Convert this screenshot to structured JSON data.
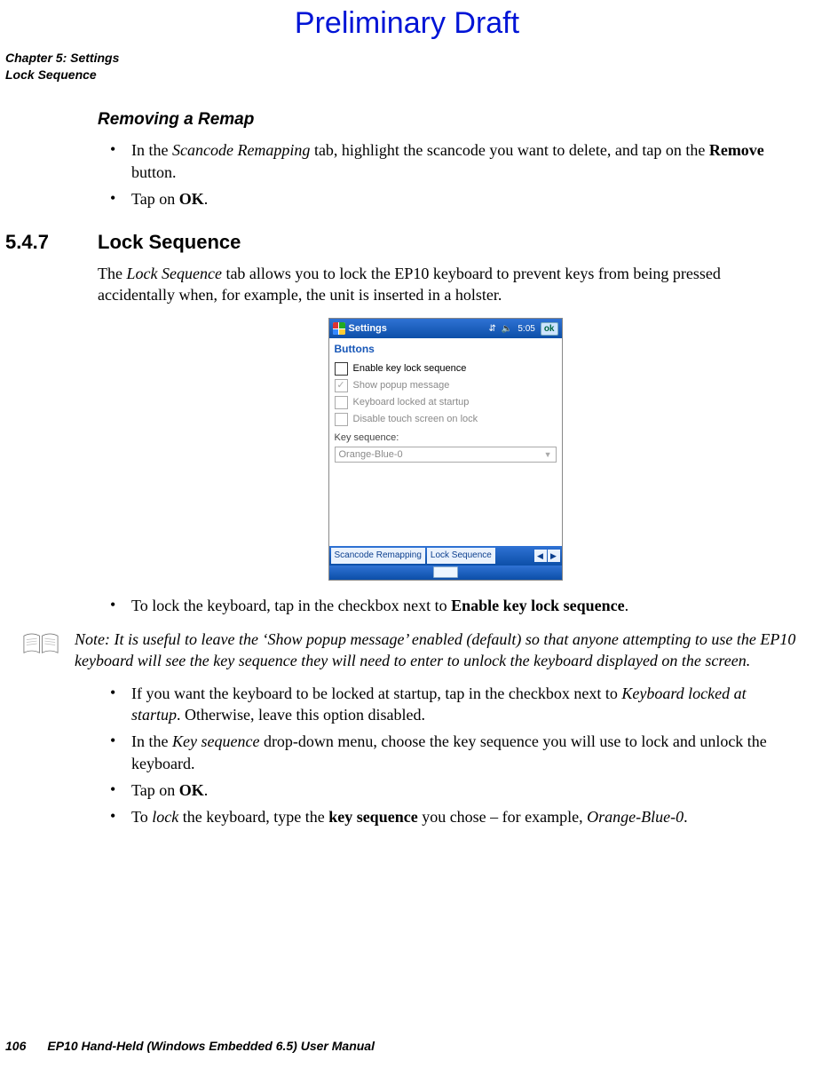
{
  "draft_header": "Preliminary Draft",
  "running_head": {
    "line1": "Chapter 5: Settings",
    "line2": "Lock Sequence"
  },
  "sections": {
    "remap_heading": "Removing a Remap",
    "remap_bullets": {
      "b1": {
        "pre1": "In the ",
        "it1": "Scancode Remapping",
        "mid1": " tab, highlight the scancode you want to delete, and tap on the ",
        "b1": "Remove",
        "post1": " button."
      },
      "b2": {
        "pre": "Tap on ",
        "b": "OK",
        "post": "."
      }
    },
    "lockseq": {
      "number": "5.4.7",
      "title": "Lock Sequence",
      "intro": {
        "pre": "The ",
        "it": "Lock Sequence",
        "post": " tab allows you to lock the EP10 keyboard to prevent keys from being pressed accidentally when, for example, the unit is inserted in a holster."
      },
      "bullet_a": {
        "pre": "To lock the keyboard, tap in the checkbox next to ",
        "b": "Enable key lock sequence",
        "post": "."
      },
      "note": "Note: It is useful to leave the ‘Show popup message’ enabled (default) so that anyone attempting to use the EP10 keyboard will see the key sequence they will need to enter to unlock the keyboard displayed on the screen.",
      "bullet_b": {
        "pre": "If you want the keyboard to be locked at startup, tap in the checkbox next to ",
        "it": "Keyboard locked at startup",
        "post": ". Otherwise, leave this option disabled."
      },
      "bullet_c": {
        "pre": "In the ",
        "it": "Key sequence",
        "post": " drop-down menu, choose the key sequence you will use to lock and unlock the keyboard."
      },
      "bullet_d": {
        "pre": "Tap on ",
        "b": "OK",
        "post": "."
      },
      "bullet_e": {
        "pre": "To ",
        "it1": "lock",
        "mid": " the keyboard, type the ",
        "b": "key sequence",
        "post_pre": " you chose – for example, ",
        "it2": "Orange-Blue-0",
        "post2": "."
      }
    }
  },
  "screenshot": {
    "title": "Settings",
    "time": "5:05",
    "ok": "ok",
    "app": "Buttons",
    "opts": {
      "enable": "Enable key lock sequence",
      "popup": "Show popup message",
      "startup": "Keyboard locked at startup",
      "touch": "Disable touch screen on lock"
    },
    "key_label": "Key sequence:",
    "combo_value": "Orange-Blue-0",
    "tabs": {
      "left": "Scancode Remapping",
      "right": "Lock Sequence"
    }
  },
  "footer": {
    "page": "106",
    "title": "EP10 Hand-Held (Windows Embedded 6.5) User Manual"
  }
}
